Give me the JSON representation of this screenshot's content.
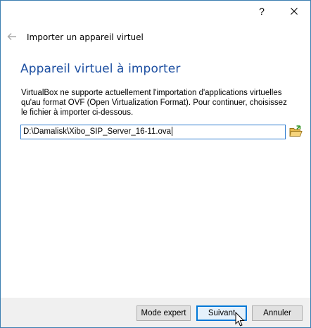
{
  "titlebar": {
    "help_label": "?",
    "close_label": "✕"
  },
  "nav": {
    "back_icon": "back-arrow-icon",
    "wizard_title": "Importer un appareil virtuel"
  },
  "page": {
    "heading": "Appareil virtuel à importer",
    "description": "VirtualBox ne supporte actuellement l'importation d'applications virtuelles qu'au format OVF (Open Virtualization Format). Pour continuer, choisissez le fichier à importer ci-dessous.",
    "file_path": "D:\\Damalisk\\Xibo_SIP_Server_16-11.ova",
    "folder_icon": "folder-open-icon"
  },
  "footer": {
    "expert_label": "Mode expert",
    "next_label": "Suivant",
    "cancel_label": "Annuler"
  },
  "colors": {
    "heading": "#1d4fa1",
    "input_border": "#2f7cd0",
    "default_button_border": "#0078d7",
    "footer_bg": "#f0f0f0"
  }
}
